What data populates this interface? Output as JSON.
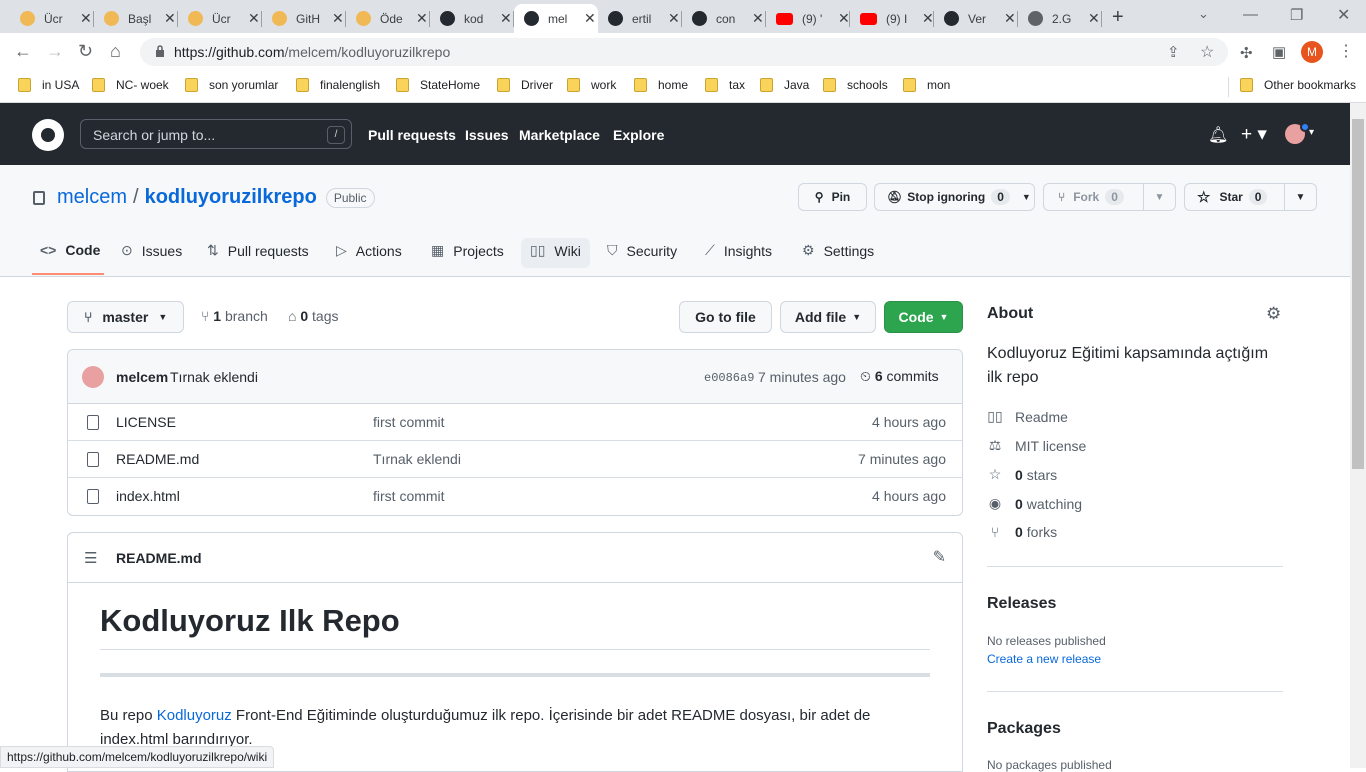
{
  "browser": {
    "tabs": [
      {
        "title": "Ücr",
        "icon": "circle-icon"
      },
      {
        "title": "Başl",
        "icon": "circle-icon"
      },
      {
        "title": "Ücr",
        "icon": "circle-icon"
      },
      {
        "title": "GitH",
        "icon": "circle-icon"
      },
      {
        "title": "Öde",
        "icon": "circle-icon"
      },
      {
        "title": "kod",
        "icon": "github-icon"
      },
      {
        "title": "mel",
        "icon": "github-icon",
        "active": true
      },
      {
        "title": "ertil",
        "icon": "github-icon"
      },
      {
        "title": "con",
        "icon": "github-icon"
      },
      {
        "title": "(9) '",
        "icon": "youtube-icon"
      },
      {
        "title": "(9) I",
        "icon": "youtube-icon"
      },
      {
        "title": "Ver",
        "icon": "github-icon"
      },
      {
        "title": "2.G",
        "icon": "globe-icon"
      }
    ],
    "url_host": "https://github.com",
    "url_path": "/melcem/kodluyoruzilkrepo",
    "profile_initial": "M",
    "bookmarks": [
      "in USA",
      "NC- woek",
      "son yorumlar",
      "finalenglish",
      "StateHome",
      "Driver",
      "work",
      "home",
      "tax",
      "Java",
      "schools",
      "mon"
    ],
    "other_bookmarks": "Other bookmarks",
    "status_url": "https://github.com/melcem/kodluyoruzilkrepo/wiki"
  },
  "header": {
    "search_placeholder": "Search or jump to...",
    "slash": "/",
    "links": [
      "Pull requests",
      "Issues",
      "Marketplace",
      "Explore"
    ]
  },
  "repo": {
    "owner": "melcem",
    "separator": "/",
    "name": "kodluyoruzilkrepo",
    "visibility": "Public",
    "pin": "Pin",
    "watch": "Stop ignoring",
    "watch_count": "0",
    "fork": "Fork",
    "fork_count": "0",
    "star": "Star",
    "star_count": "0",
    "tabs": [
      "Code",
      "Issues",
      "Pull requests",
      "Actions",
      "Projects",
      "Wiki",
      "Security",
      "Insights",
      "Settings"
    ]
  },
  "code": {
    "branch": "master",
    "branch_count": "1",
    "branch_label": "branch",
    "tag_count": "0",
    "tag_label": "tags",
    "go_to_file": "Go to file",
    "add_file": "Add file",
    "code_button": "Code",
    "commit": {
      "author": "melcem",
      "message": "Tırnak eklendi",
      "sha": "e0086a9",
      "time": "7 minutes ago",
      "commit_count": "6",
      "commits_label": "commits"
    },
    "files": [
      {
        "name": "LICENSE",
        "message": "first commit",
        "time": "4 hours ago"
      },
      {
        "name": "README.md",
        "message": "Tırnak eklendi",
        "time": "7 minutes ago"
      },
      {
        "name": "index.html",
        "message": "first commit",
        "time": "4 hours ago"
      }
    ]
  },
  "readme": {
    "filename": "README.md",
    "heading": "Kodluyoruz Ilk Repo",
    "para_start": "Bu repo ",
    "link": "Kodluyoruz",
    "para_line1_rest": " Front-End Eğitiminde oluşturduğumuz ilk repo. İçerisinde bir adet README dosyası, bir adet de",
    "para_line2": "index.html barındırıyor."
  },
  "about": {
    "title": "About",
    "description": "Kodluyoruz Eğitimi kapsamında açtığım ilk repo",
    "readme": "Readme",
    "license": "MIT license",
    "stars_count": "0",
    "stars_label": "stars",
    "watching_count": "0",
    "watching_label": "watching",
    "forks_count": "0",
    "forks_label": "forks",
    "releases_title": "Releases",
    "no_releases": "No releases published",
    "create_release": "Create a new release",
    "packages_title": "Packages",
    "no_packages": "No packages published"
  }
}
